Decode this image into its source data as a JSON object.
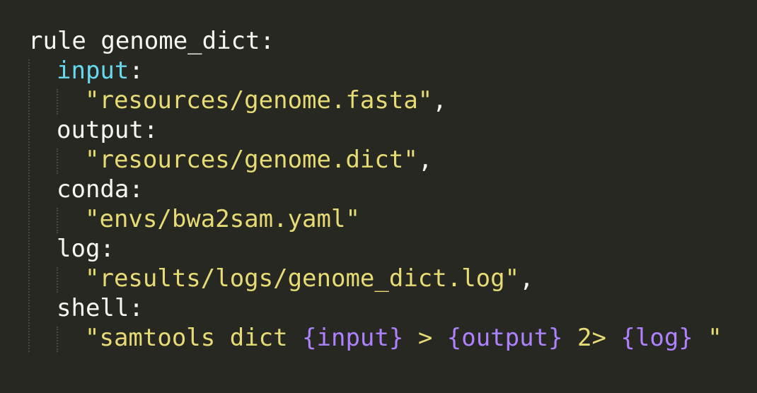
{
  "editor": {
    "theme_colors": {
      "background": "#272822",
      "default": "#f8f8f2",
      "string": "#e6db74",
      "directive_input": "#66d9ef",
      "interpolation": "#ae81ff"
    },
    "lines": [
      {
        "parts": [
          {
            "text": "rule genome_dict:",
            "kind": "plain"
          }
        ]
      },
      {
        "parts": [
          {
            "text": "input",
            "kind": "builtin"
          },
          {
            "text": ":",
            "kind": "plain"
          }
        ]
      },
      {
        "parts": [
          {
            "text": "\"resources/genome.fasta\"",
            "kind": "str"
          },
          {
            "text": ",",
            "kind": "plain"
          }
        ]
      },
      {
        "parts": [
          {
            "text": "output:",
            "kind": "plain"
          }
        ]
      },
      {
        "parts": [
          {
            "text": "\"resources/genome.dict\"",
            "kind": "str"
          },
          {
            "text": ",",
            "kind": "plain"
          }
        ]
      },
      {
        "parts": [
          {
            "text": "conda:",
            "kind": "plain"
          }
        ]
      },
      {
        "parts": [
          {
            "text": "\"envs/bwa2sam.yaml\"",
            "kind": "str"
          }
        ]
      },
      {
        "parts": [
          {
            "text": "log:",
            "kind": "plain"
          }
        ]
      },
      {
        "parts": [
          {
            "text": "\"results/logs/genome_dict.log\"",
            "kind": "str"
          },
          {
            "text": ",",
            "kind": "plain"
          }
        ]
      },
      {
        "parts": [
          {
            "text": "shell:",
            "kind": "plain"
          }
        ]
      },
      {
        "parts": [
          {
            "text": "\"samtools dict ",
            "kind": "str"
          },
          {
            "text": "{input}",
            "kind": "interp"
          },
          {
            "text": " > ",
            "kind": "str"
          },
          {
            "text": "{output}",
            "kind": "interp"
          },
          {
            "text": " 2> ",
            "kind": "str"
          },
          {
            "text": "{log}",
            "kind": "interp"
          },
          {
            "text": " \"",
            "kind": "str"
          }
        ]
      }
    ]
  }
}
